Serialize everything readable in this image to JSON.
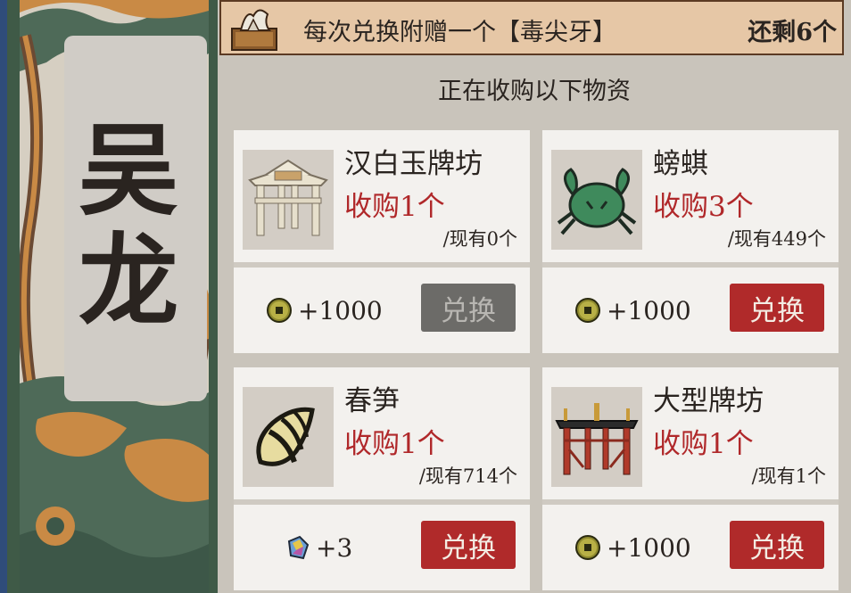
{
  "npc": {
    "name_line1": "吴",
    "name_line2": "龙"
  },
  "banner": {
    "gift_text": "每次兑换附赠一个【毒尖牙】",
    "remaining_text": "还剩6个"
  },
  "heading": "正在收购以下物资",
  "colors": {
    "request_red": "#b0282a",
    "button_red": "#b02a2a",
    "button_disabled": "#6c6b68",
    "banner_bg": "#e6c7a6"
  },
  "items": [
    {
      "name": "汉白玉牌坊",
      "request": "收购1个",
      "owned": "/现有0个",
      "icon": "white-jade-archway-icon",
      "reward_icon": "copper-coin-icon",
      "reward": "+1000",
      "button": "兑换",
      "button_state": "disabled"
    },
    {
      "name": "螃蜞",
      "request": "收购3个",
      "owned": "/现有449个",
      "icon": "crab-icon",
      "reward_icon": "copper-coin-icon",
      "reward": "+1000",
      "button": "兑换",
      "button_state": "active"
    },
    {
      "name": "春笋",
      "request": "收购1个",
      "owned": "/现有714个",
      "icon": "bamboo-shoot-icon",
      "reward_icon": "gem-icon",
      "reward": "+3",
      "button": "兑换",
      "button_state": "active"
    },
    {
      "name": "大型牌坊",
      "request": "收购1个",
      "owned": "/现有1个",
      "icon": "large-archway-icon",
      "reward_icon": "copper-coin-icon",
      "reward": "+1000",
      "button": "兑换",
      "button_state": "active"
    }
  ]
}
